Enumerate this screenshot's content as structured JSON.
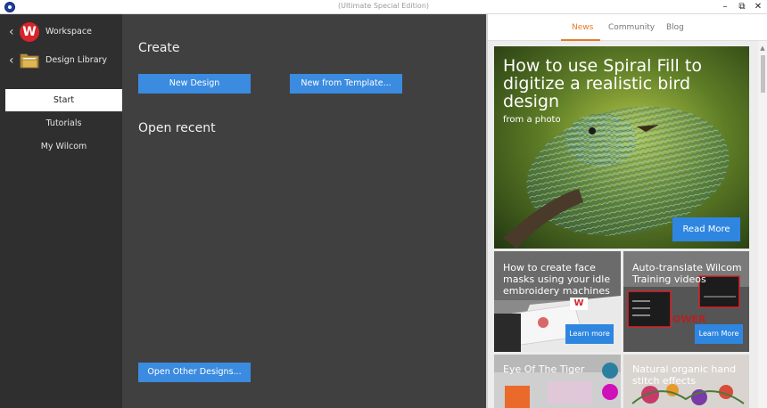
{
  "titlebar": {
    "title": "(Ultimate Special Edition)",
    "minimize_glyph": "–",
    "restore_glyph": "⧉",
    "close_glyph": "✕"
  },
  "sidebar": {
    "nav": [
      {
        "label": "Workspace",
        "icon": "wilcom-logo-icon"
      },
      {
        "label": "Design Library",
        "icon": "folder-icon"
      }
    ],
    "tabs": [
      {
        "label": "Start",
        "active": true
      },
      {
        "label": "Tutorials",
        "active": false
      },
      {
        "label": "My Wilcom",
        "active": false
      }
    ]
  },
  "center": {
    "create_title": "Create",
    "new_design": "New Design",
    "new_from_template": "New from Template...",
    "open_recent_title": "Open recent",
    "open_other": "Open Other Designs..."
  },
  "right": {
    "tabs": [
      {
        "label": "News",
        "active": true
      },
      {
        "label": "Community",
        "active": false
      },
      {
        "label": "Blog",
        "active": false
      }
    ],
    "hero": {
      "title": "How to use Spiral Fill to digitize a realistic bird design",
      "subtitle": "from a photo",
      "button": "Read More"
    },
    "cards": [
      {
        "title": "How to create face masks using your idle embroidery machines",
        "button": "Learn more",
        "logo": "W"
      },
      {
        "title": "Auto-translate Wilcom Training videos",
        "button": "Learn More"
      },
      {
        "title": "Eye Of The Tiger"
      },
      {
        "title": "Natural organic hand stitch effects"
      }
    ]
  },
  "colors": {
    "accent_blue": "#3b8be0",
    "accent_orange": "#e27b2b",
    "brand_red": "#d8242a"
  }
}
